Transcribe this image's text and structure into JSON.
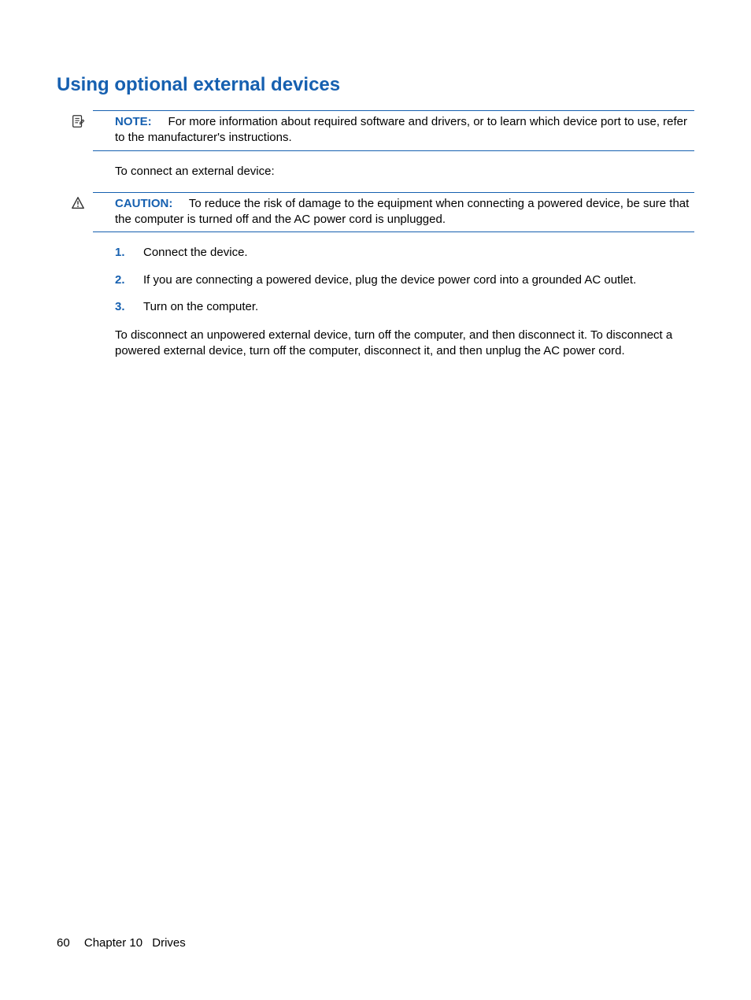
{
  "heading": "Using optional external devices",
  "note": {
    "label": "NOTE:",
    "text": "For more information about required software and drivers, or to learn which device port to use, refer to the manufacturer's instructions."
  },
  "intro": "To connect an external device:",
  "caution": {
    "label": "CAUTION:",
    "text": "To reduce the risk of damage to the equipment when connecting a powered device, be sure that the computer is turned off and the AC power cord is unplugged."
  },
  "steps": [
    {
      "num": "1.",
      "text": "Connect the device."
    },
    {
      "num": "2.",
      "text": "If you are connecting a powered device, plug the device power cord into a grounded AC outlet."
    },
    {
      "num": "3.",
      "text": "Turn on the computer."
    }
  ],
  "closing": "To disconnect an unpowered external device, turn off the computer, and then disconnect it. To disconnect a powered external device, turn off the computer, disconnect it, and then unplug the AC power cord.",
  "footer": {
    "page": "60",
    "chapter": "Chapter 10",
    "title": "Drives"
  }
}
